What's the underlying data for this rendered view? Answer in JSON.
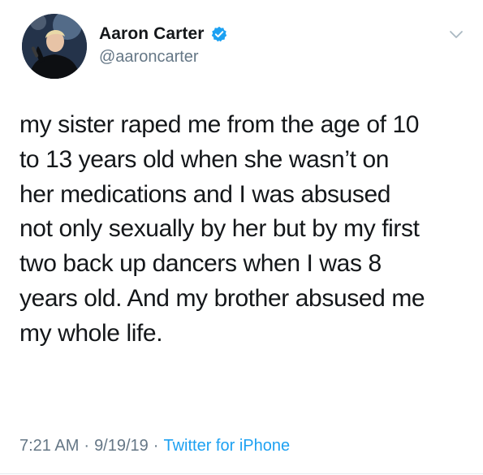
{
  "user": {
    "display_name": "Aaron Carter",
    "handle": "@aaroncarter",
    "verified": true,
    "avatar_icon": "profile-photo"
  },
  "tweet": {
    "text": "my sister raped me from the age of 10\nto 13 years old when she wasn’t on\nher medications and I was absused\nnot only sexually by her but by my first\ntwo back up dancers when I was 8\nyears old. And my brother absused me\nmy whole life.",
    "time": "7:21 AM",
    "date": "9/19/19",
    "separator": "·",
    "source": "Twitter for iPhone"
  },
  "icons": {
    "verified": "verified-badge-icon",
    "menu": "chevron-down-icon"
  },
  "colors": {
    "text": "#14171a",
    "secondary": "#657786",
    "accent": "#1da1f2"
  }
}
